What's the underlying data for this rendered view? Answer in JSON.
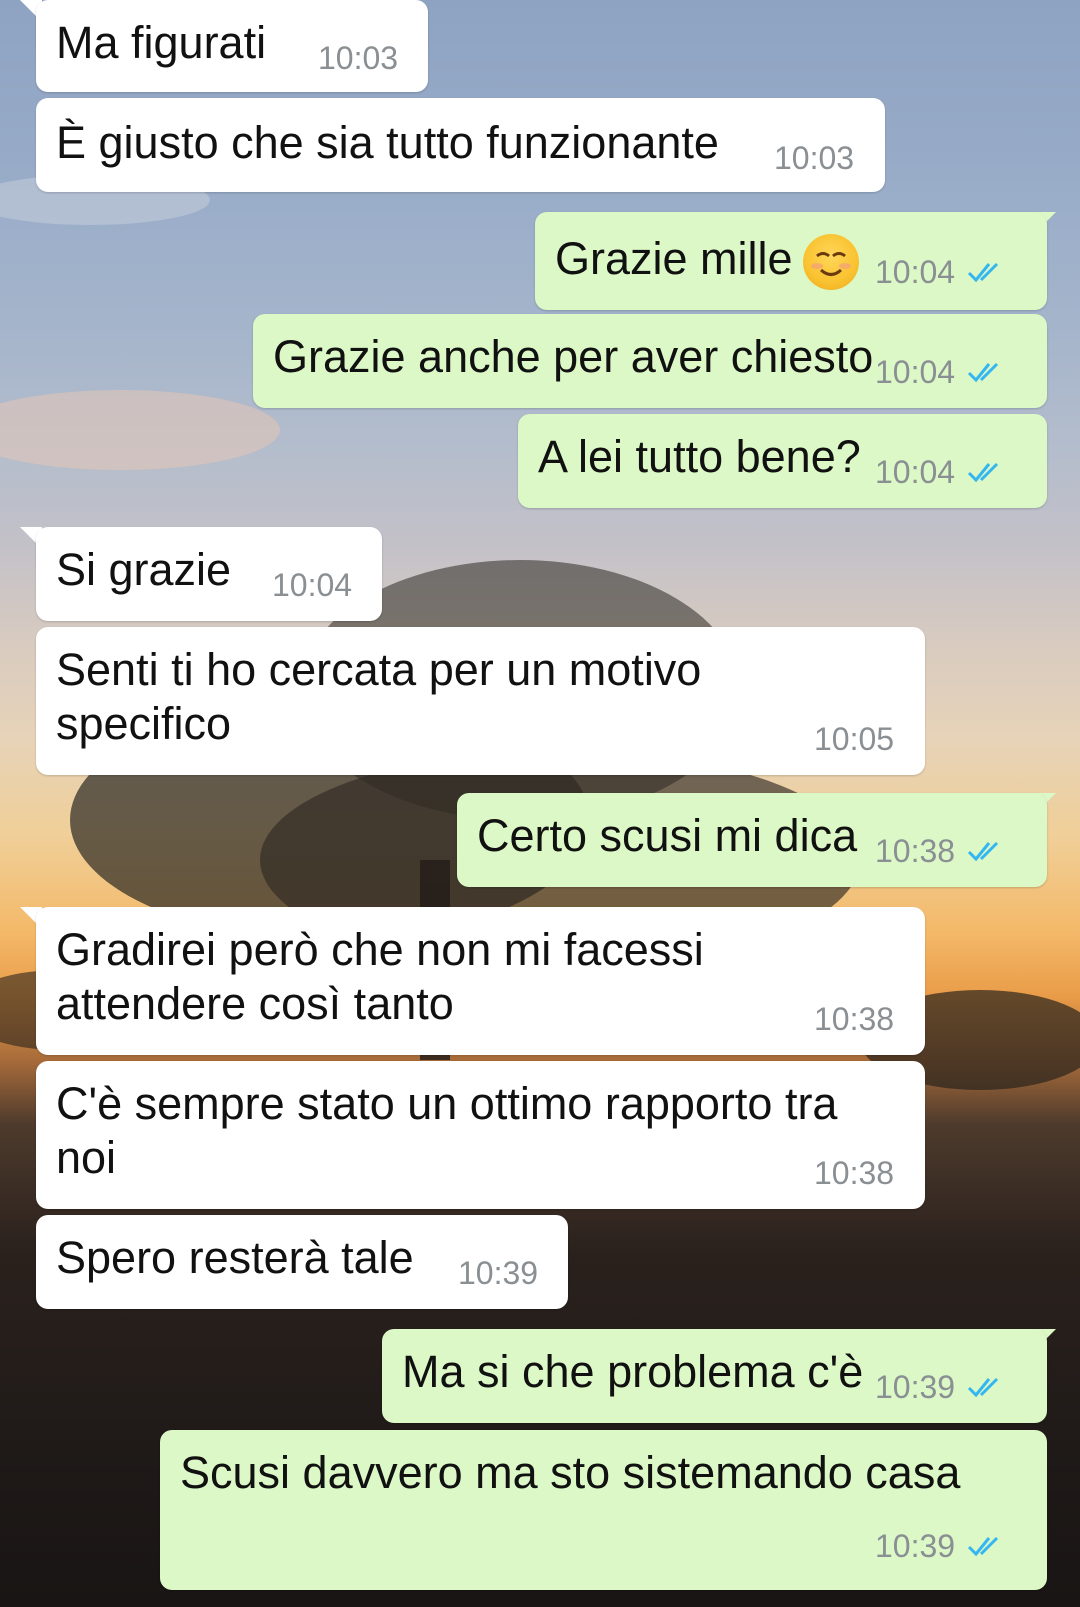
{
  "messages": [
    {
      "text": "Ma figurati",
      "time": "10:03",
      "dir": "in"
    },
    {
      "text": "È giusto che sia tutto funzionante",
      "time": "10:03",
      "dir": "in"
    },
    {
      "text": "Grazie mille",
      "time": "10:04",
      "dir": "out",
      "emoji": "smiling-face-icon"
    },
    {
      "text": "Grazie anche per aver chiesto",
      "time": "10:04",
      "dir": "out"
    },
    {
      "text": "A lei tutto bene?",
      "time": "10:04",
      "dir": "out"
    },
    {
      "text": "Si grazie",
      "time": "10:04",
      "dir": "in"
    },
    {
      "line1": "Senti ti ho cercata per un motivo",
      "line2": "specifico",
      "time": "10:05",
      "dir": "in"
    },
    {
      "text": "Certo scusi mi dica",
      "time": "10:38",
      "dir": "out"
    },
    {
      "line1": "Gradirei però che non mi facessi",
      "line2": "attendere così tanto",
      "time": "10:38",
      "dir": "in"
    },
    {
      "line1": "C'è sempre stato un ottimo rapporto tra",
      "line2": "noi",
      "time": "10:38",
      "dir": "in"
    },
    {
      "text": "Spero resterà tale",
      "time": "10:39",
      "dir": "in"
    },
    {
      "text": "Ma si che problema c'è",
      "time": "10:39",
      "dir": "out"
    },
    {
      "text": "Scusi davvero ma sto sistemando casa",
      "time": "10:39",
      "dir": "out"
    }
  ],
  "colors": {
    "incoming_bubble": "#ffffff",
    "outgoing_bubble": "#dcf8c6",
    "read_ticks": "#34b7f1",
    "timestamp": "#8a8f93"
  },
  "icons": {
    "read_receipt": "double-check-icon"
  }
}
